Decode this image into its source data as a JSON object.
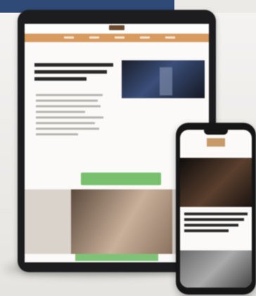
{
  "scene": {
    "subject": "tablet-and-phone-mockup",
    "colors": {
      "background": "#eceae6",
      "navy_band": "#2f4a76",
      "tablet_nav": "#d79a5f",
      "accent_green": "#78c06e",
      "device_frame": "#1d1d1f"
    }
  }
}
